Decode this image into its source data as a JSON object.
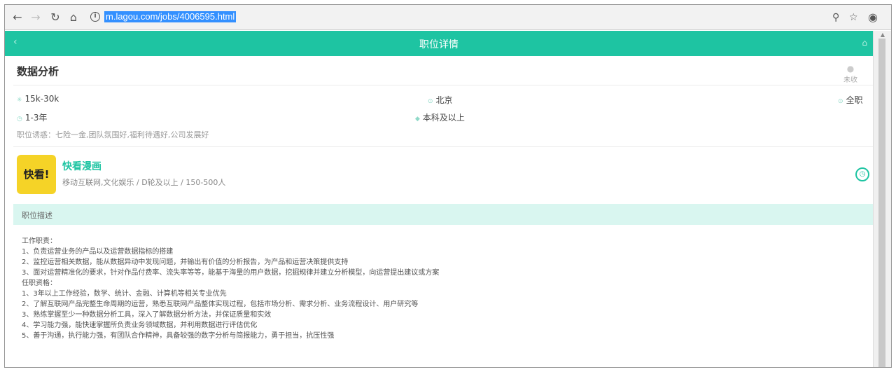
{
  "browser": {
    "url": "m.lagou.com/jobs/4006595.html",
    "icons": [
      "back-arrow-icon",
      "forward-arrow-icon",
      "reload-icon",
      "home-icon",
      "info-icon",
      "zoom-icon",
      "bookmark-star-icon",
      "extension-icon"
    ]
  },
  "header": {
    "title": "职位详情"
  },
  "job": {
    "title": "数据分析",
    "collect_label": "未收",
    "salary": "15k-30k",
    "city": "北京",
    "job_type": "全职",
    "experience": "1-3年",
    "education": "本科及以上",
    "perks": "职位诱惑：七险一金,团队氛围好,福利待遇好,公司发展好"
  },
  "company": {
    "logo_text": "快看!",
    "name": "快看漫画",
    "info": "移动互联网,文化娱乐 / D轮及以上 / 150-500人"
  },
  "description": {
    "section_label": "职位描述",
    "lines": [
      "工作职责：",
      "1、负责运营业务的产品以及运营数据指标的搭建",
      "2、监控运营相关数据，能从数据异动中发现问题，并输出有价值的分析报告，为产品和运营决策提供支持",
      "3、面对运营精准化的要求，针对作品付费率、流失率等等，能基于海量的用户数据，挖掘规律并建立分析模型，向运营提出建议或方案",
      "任职资格：",
      "1、3年以上工作经验，数学、统计、金融、计算机等相关专业优先",
      "2、了解互联网产品完整生命周期的运营，熟悉互联网产品整体实现过程，包括市场分析、需求分析、业务流程设计、用户研究等",
      "3、熟练掌握至少一种数据分析工具，深入了解数据分析方法，并保证质量和实效",
      "4、学习能力强，能快速掌握所负责业务领域数据，并利用数据进行评估优化",
      "5、善于沟通，执行能力强，有团队合作精神，具备较强的数字分析与简报能力，勇于担当，抗压性强"
    ]
  },
  "colors": {
    "accent": "#1ec4a2",
    "section_bg": "#d9f6f0",
    "logo_bg": "#f5d327"
  }
}
